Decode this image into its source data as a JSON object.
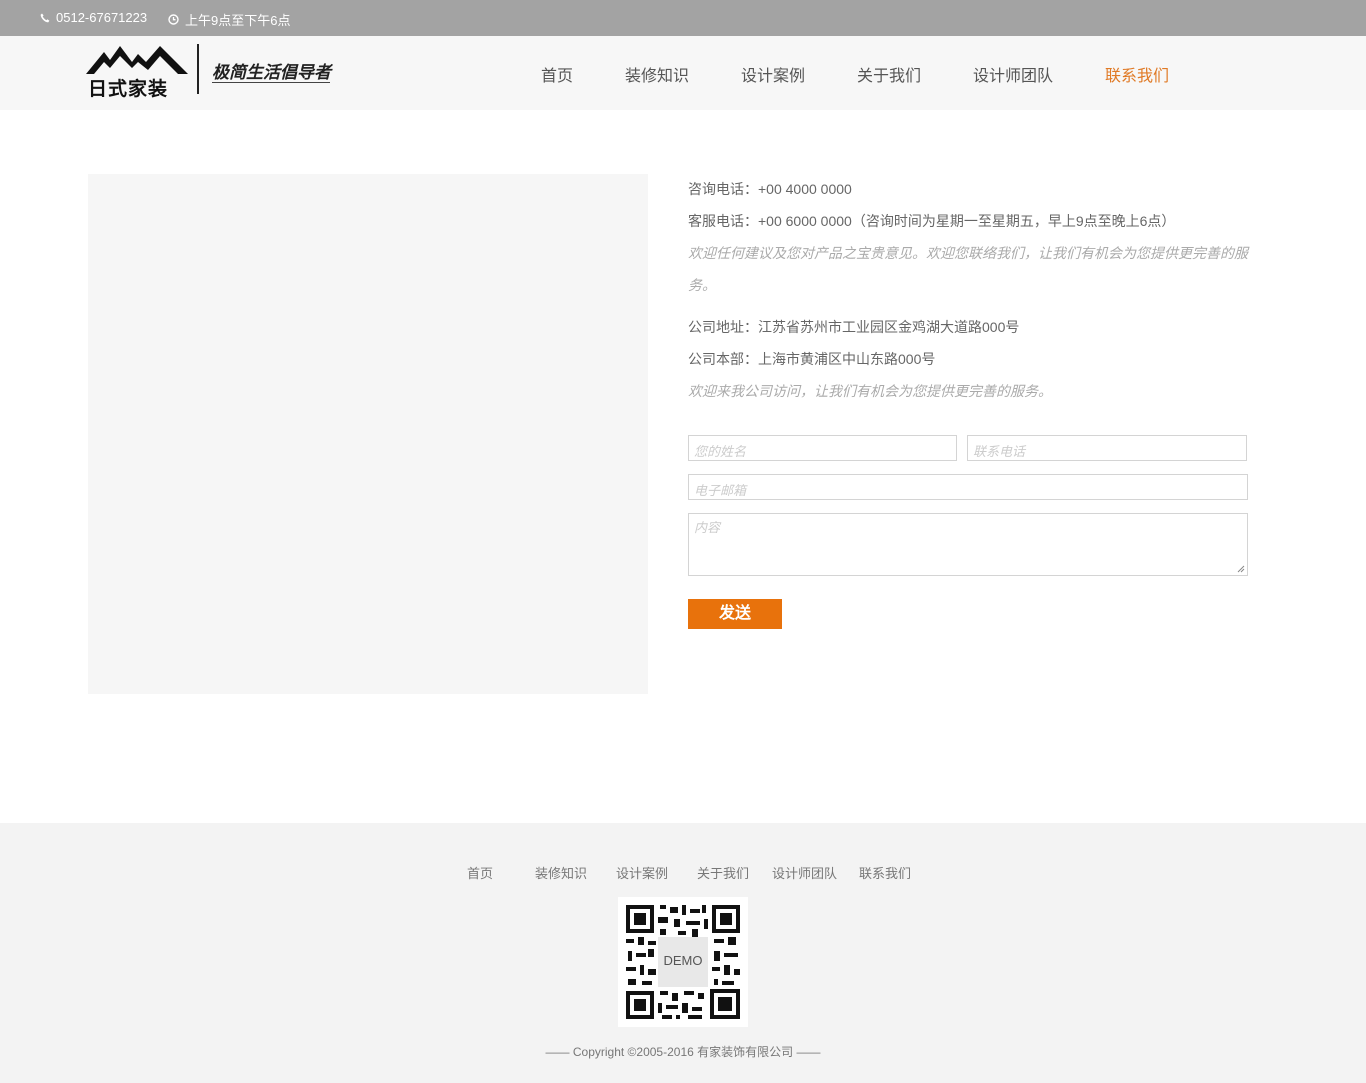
{
  "topbar": {
    "phone_icon": "phone-icon",
    "phone": "0512-67671223",
    "clock_icon": "clock-icon",
    "hours": "上午9点至下午6点"
  },
  "header": {
    "logo": {
      "brand": "日式家装",
      "slogan": "极简生活倡导者"
    },
    "nav": [
      "首页",
      "装修知识",
      "设计案例",
      "关于我们",
      "设计师团队",
      "联系我们"
    ],
    "active_nav": "联系我们"
  },
  "contact": {
    "line1": "咨询电话：+00 4000 0000",
    "line2": "客服电话：+00 6000 0000（咨询时间为星期一至星期五，早上9点至晚上6点）",
    "note1": "欢迎任何建议及您对产品之宝贵意见。欢迎您联络我们，让我们有机会为您提供更完善的服务。",
    "address": "公司地址：江苏省苏州市工业园区金鸡湖大道路000号",
    "hq": "公司本部：上海市黄浦区中山东路000号",
    "note2": "欢迎来我公司访问，让我们有机会为您提供更完善的服务。"
  },
  "form": {
    "name_placeholder": "您的姓名",
    "phone_placeholder": "联系电话",
    "email_placeholder": "电子邮箱",
    "content_placeholder": "内容",
    "submit": "发送"
  },
  "footer": {
    "nav": [
      "首页",
      "装修知识",
      "设计案例",
      "关于我们",
      "设计师团队",
      "联系我们"
    ],
    "qr_label": "DEMO",
    "copyright": "—— Copyright ©2005-2016 有家装饰有限公司 ——"
  },
  "colors": {
    "topbar_bg": "#a3a3a3",
    "accent": "#e8720c",
    "active_nav": "#e07a26"
  }
}
